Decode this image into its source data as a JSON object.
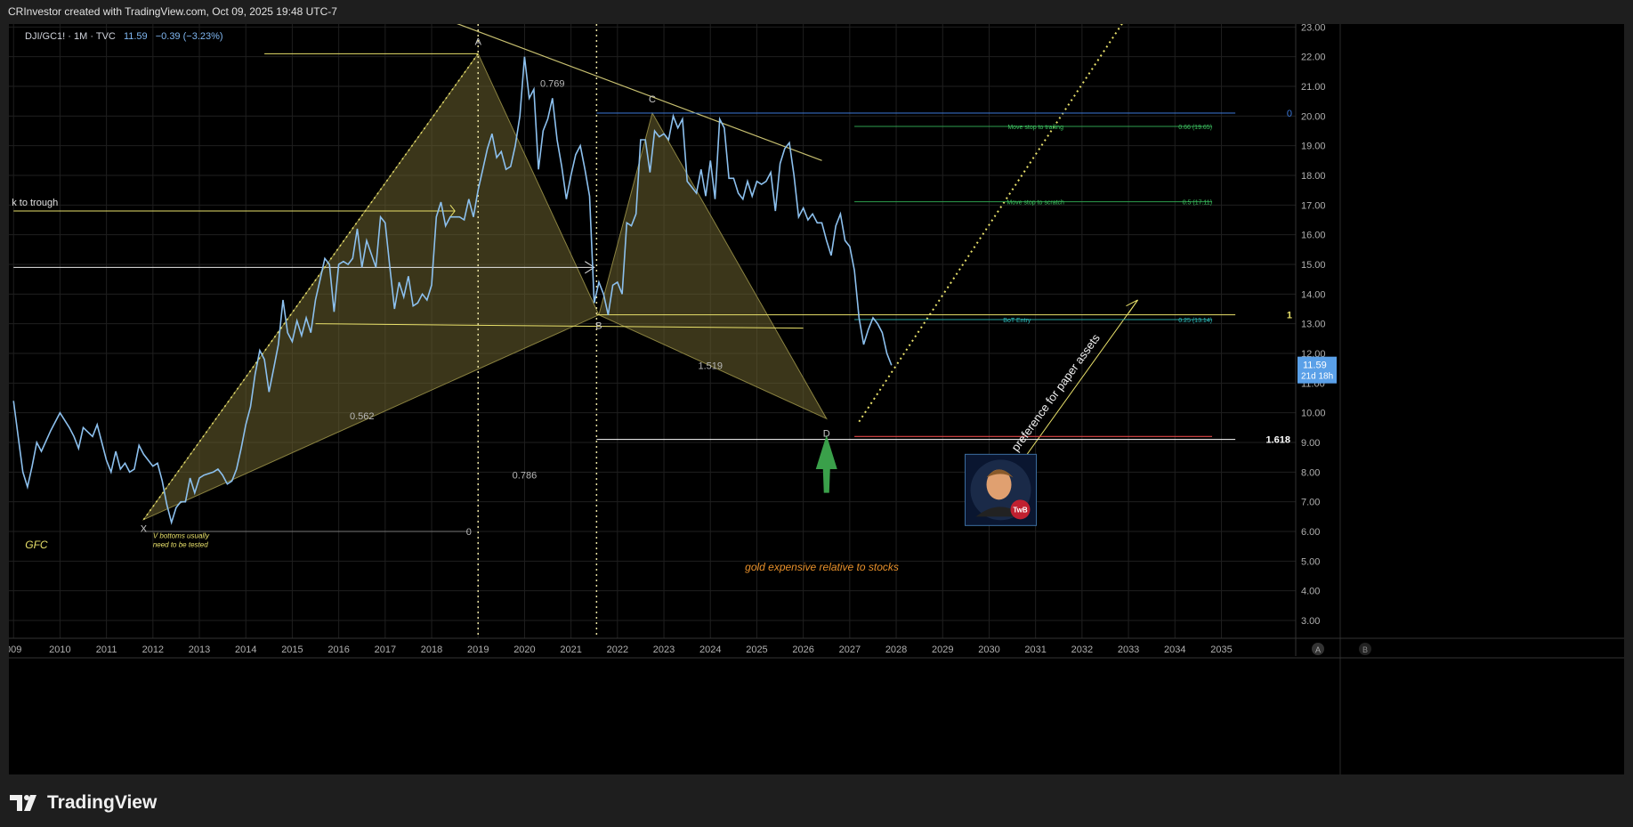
{
  "header": {
    "attribution": "CRInvestor created with TradingView.com, Oct 09, 2025 19:48 UTC-7"
  },
  "symbol": {
    "name": "DJI/GC1! · 1M · TVC",
    "last": "11.59",
    "change": "−0.39 (−3.23%)"
  },
  "footer": {
    "brand": "TradingView"
  },
  "colors": {
    "price_line": "#8cc0ee",
    "pattern_fill": "#6b6330",
    "yellow": "#e8e06a",
    "green": "#4caf50",
    "red": "#e04848",
    "orange": "#e8902a",
    "blue_line": "#3c78d8"
  },
  "chart_data": {
    "type": "line",
    "symbol": "DJI/GC1!",
    "interval": "1M",
    "x_label_values": [
      "009",
      "2010",
      "2011",
      "2012",
      "2013",
      "2014",
      "2015",
      "2016",
      "2017",
      "2018",
      "2019",
      "2020",
      "2021",
      "2022",
      "2023",
      "2024",
      "2025",
      "2026",
      "2027",
      "2028",
      "2029",
      "2030",
      "2031",
      "2032",
      "2033",
      "2034",
      "2035"
    ],
    "y_label_values": [
      "3.00",
      "4.00",
      "5.00",
      "6.00",
      "7.00",
      "8.00",
      "9.00",
      "10.00",
      "11.00",
      "12.00",
      "13.00",
      "14.00",
      "15.00",
      "16.00",
      "17.00",
      "18.00",
      "19.00",
      "20.00",
      "21.00",
      "22.00",
      "23.00"
    ],
    "ylim": [
      2.4,
      23.1
    ],
    "xlim": [
      2008.9,
      2036.6
    ],
    "grid": true,
    "series": [
      {
        "values": [
          [
            2009.0,
            10.4
          ],
          [
            2009.1,
            9.2
          ],
          [
            2009.2,
            8.0
          ],
          [
            2009.3,
            7.5
          ],
          [
            2009.4,
            8.2
          ],
          [
            2009.5,
            9.0
          ],
          [
            2009.6,
            8.7
          ],
          [
            2009.8,
            9.4
          ],
          [
            2010.0,
            10.0
          ],
          [
            2010.2,
            9.5
          ],
          [
            2010.3,
            9.2
          ],
          [
            2010.4,
            8.8
          ],
          [
            2010.5,
            9.5
          ],
          [
            2010.7,
            9.2
          ],
          [
            2010.8,
            9.6
          ],
          [
            2010.9,
            9.0
          ],
          [
            2011.0,
            8.4
          ],
          [
            2011.1,
            8.0
          ],
          [
            2011.2,
            8.7
          ],
          [
            2011.3,
            8.1
          ],
          [
            2011.4,
            8.3
          ],
          [
            2011.5,
            8.0
          ],
          [
            2011.6,
            8.1
          ],
          [
            2011.7,
            8.9
          ],
          [
            2011.8,
            8.6
          ],
          [
            2011.9,
            8.4
          ],
          [
            2012.0,
            8.2
          ],
          [
            2012.1,
            8.3
          ],
          [
            2012.2,
            7.7
          ],
          [
            2012.3,
            6.9
          ],
          [
            2012.4,
            6.3
          ],
          [
            2012.5,
            6.8
          ],
          [
            2012.6,
            7.0
          ],
          [
            2012.7,
            7.0
          ],
          [
            2012.8,
            7.8
          ],
          [
            2012.9,
            7.3
          ],
          [
            2013.0,
            7.8
          ],
          [
            2013.1,
            7.9
          ],
          [
            2013.3,
            8.0
          ],
          [
            2013.4,
            8.1
          ],
          [
            2013.5,
            7.9
          ],
          [
            2013.6,
            7.6
          ],
          [
            2013.7,
            7.7
          ],
          [
            2013.8,
            8.1
          ],
          [
            2013.9,
            8.8
          ],
          [
            2014.0,
            9.6
          ],
          [
            2014.1,
            10.2
          ],
          [
            2014.2,
            11.3
          ],
          [
            2014.3,
            12.1
          ],
          [
            2014.4,
            11.8
          ],
          [
            2014.5,
            10.7
          ],
          [
            2014.6,
            11.5
          ],
          [
            2014.7,
            12.3
          ],
          [
            2014.8,
            13.8
          ],
          [
            2014.9,
            12.7
          ],
          [
            2015.0,
            12.4
          ],
          [
            2015.1,
            13.1
          ],
          [
            2015.2,
            12.6
          ],
          [
            2015.3,
            13.2
          ],
          [
            2015.4,
            12.7
          ],
          [
            2015.5,
            13.8
          ],
          [
            2015.6,
            14.5
          ],
          [
            2015.7,
            15.2
          ],
          [
            2015.8,
            15.0
          ],
          [
            2015.9,
            13.4
          ],
          [
            2016.0,
            15.0
          ],
          [
            2016.1,
            15.1
          ],
          [
            2016.2,
            15.0
          ],
          [
            2016.3,
            15.2
          ],
          [
            2016.4,
            16.2
          ],
          [
            2016.5,
            14.9
          ],
          [
            2016.6,
            15.8
          ],
          [
            2016.8,
            14.9
          ],
          [
            2016.9,
            16.6
          ],
          [
            2017.0,
            16.4
          ],
          [
            2017.1,
            14.9
          ],
          [
            2017.2,
            13.5
          ],
          [
            2017.3,
            14.4
          ],
          [
            2017.4,
            13.9
          ],
          [
            2017.5,
            14.6
          ],
          [
            2017.6,
            13.6
          ],
          [
            2017.7,
            13.7
          ],
          [
            2017.8,
            14.0
          ],
          [
            2017.9,
            13.8
          ],
          [
            2018.0,
            14.3
          ],
          [
            2018.1,
            16.6
          ],
          [
            2018.2,
            17.1
          ],
          [
            2018.3,
            16.3
          ],
          [
            2018.4,
            16.6
          ],
          [
            2018.6,
            16.6
          ],
          [
            2018.7,
            16.5
          ],
          [
            2018.8,
            17.2
          ],
          [
            2018.9,
            16.6
          ],
          [
            2019.0,
            17.5
          ],
          [
            2019.1,
            18.2
          ],
          [
            2019.2,
            18.9
          ],
          [
            2019.3,
            19.4
          ],
          [
            2019.4,
            18.6
          ],
          [
            2019.5,
            18.8
          ],
          [
            2019.6,
            18.2
          ],
          [
            2019.7,
            18.3
          ],
          [
            2019.8,
            19.0
          ],
          [
            2019.9,
            20.0
          ],
          [
            2020.0,
            22.0
          ],
          [
            2020.1,
            20.6
          ],
          [
            2020.2,
            20.9
          ],
          [
            2020.3,
            18.2
          ],
          [
            2020.4,
            19.5
          ],
          [
            2020.5,
            19.9
          ],
          [
            2020.6,
            20.6
          ],
          [
            2020.7,
            19.2
          ],
          [
            2020.8,
            18.3
          ],
          [
            2020.9,
            17.2
          ],
          [
            2021.0,
            18.0
          ],
          [
            2021.1,
            18.7
          ],
          [
            2021.2,
            19.0
          ],
          [
            2021.3,
            18.2
          ],
          [
            2021.4,
            17.3
          ],
          [
            2021.5,
            13.7
          ],
          [
            2021.6,
            14.4
          ],
          [
            2021.7,
            14.0
          ],
          [
            2021.8,
            13.3
          ],
          [
            2021.9,
            14.3
          ],
          [
            2022.0,
            14.4
          ],
          [
            2022.1,
            14.0
          ],
          [
            2022.2,
            16.4
          ],
          [
            2022.3,
            16.3
          ],
          [
            2022.4,
            16.7
          ],
          [
            2022.5,
            19.2
          ],
          [
            2022.6,
            19.2
          ],
          [
            2022.7,
            18.1
          ],
          [
            2022.8,
            19.5
          ],
          [
            2022.9,
            19.3
          ],
          [
            2023.0,
            19.4
          ],
          [
            2023.1,
            19.2
          ],
          [
            2023.2,
            20.0
          ],
          [
            2023.3,
            19.6
          ],
          [
            2023.4,
            19.9
          ],
          [
            2023.5,
            17.8
          ],
          [
            2023.6,
            17.6
          ],
          [
            2023.7,
            17.4
          ],
          [
            2023.8,
            18.2
          ],
          [
            2023.9,
            17.3
          ],
          [
            2024.0,
            18.5
          ],
          [
            2024.1,
            17.2
          ],
          [
            2024.2,
            19.9
          ],
          [
            2024.3,
            19.6
          ],
          [
            2024.4,
            17.9
          ],
          [
            2024.5,
            17.9
          ],
          [
            2024.6,
            17.4
          ],
          [
            2024.7,
            17.2
          ],
          [
            2024.8,
            17.8
          ],
          [
            2024.9,
            17.3
          ],
          [
            2025.0,
            17.8
          ],
          [
            2025.1,
            17.7
          ],
          [
            2025.2,
            17.8
          ],
          [
            2025.3,
            18.1
          ],
          [
            2025.4,
            16.8
          ],
          [
            2025.5,
            18.4
          ],
          [
            2025.6,
            18.9
          ],
          [
            2025.7,
            19.1
          ],
          [
            2025.8,
            18.0
          ],
          [
            2025.9,
            16.6
          ],
          [
            2026.0,
            16.9
          ],
          [
            2026.1,
            16.5
          ],
          [
            2026.2,
            16.7
          ],
          [
            2026.3,
            16.4
          ],
          [
            2026.4,
            16.4
          ],
          [
            2026.5,
            15.8
          ],
          [
            2026.6,
            15.3
          ],
          [
            2026.7,
            16.3
          ],
          [
            2026.8,
            16.7
          ],
          [
            2026.9,
            15.8
          ],
          [
            2027.0,
            15.6
          ],
          [
            2027.1,
            14.8
          ],
          [
            2027.2,
            13.2
          ],
          [
            2027.3,
            12.3
          ],
          [
            2027.4,
            12.8
          ],
          [
            2027.5,
            13.2
          ],
          [
            2027.6,
            13.0
          ],
          [
            2027.7,
            12.7
          ],
          [
            2027.8,
            12.0
          ],
          [
            2027.9,
            11.6
          ]
        ]
      }
    ],
    "last_value_tag": [
      "11.59",
      "21d 18h"
    ],
    "annotations": {
      "pattern_points": [
        "X",
        "A",
        "B",
        "C",
        "D"
      ],
      "ratios": [
        "0.769",
        "0.562",
        "0.786",
        "1.519",
        "0"
      ],
      "extension_label": "1.618",
      "level_labels": [
        "0",
        "1"
      ],
      "text_labels": {
        "peak_to_trough": "k to trough",
        "gfc": "GFC",
        "v_bottoms": [
          "V bottoms usually",
          "need to be tested"
        ],
        "gold_note": "gold expensive relative to stocks",
        "paper_assets": "preference for paper assets"
      },
      "position_tool": {
        "trailing": "Move stop to trailing",
        "trailing_level": "0.66 (19.65)",
        "scratch": "Move stop to scratch",
        "scratch_level": "0.5 (17.11)",
        "entry": "BoT Entry",
        "entry_level": "0.25 (13.14)"
      },
      "avatar_badge": "TwB",
      "time_buttons": [
        "A",
        "B"
      ]
    }
  }
}
